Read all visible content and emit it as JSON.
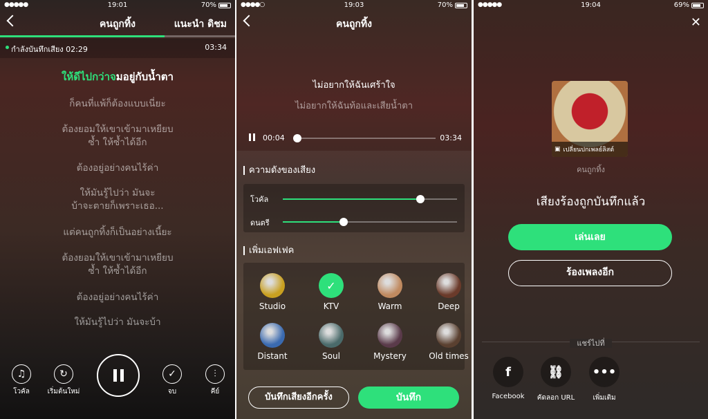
{
  "screens": [
    {
      "status": {
        "signal": "●●●●●",
        "time": "19:01",
        "battery": "70%",
        "battery_level": 0.7
      },
      "nav": {
        "title": "คนถูกทิ้ง",
        "artist": "แนะนำ ดิชม"
      },
      "progress": 0.7,
      "recording": {
        "label": "กำลังบันทึกเสียง 02:29",
        "total": "03:34"
      },
      "current_lyric": {
        "sung": "ให้ดีไปกว่าจ",
        "rest": "มอยู่กับน้ำตา"
      },
      "lyrics": [
        "ก็คนที่แพ้ก็ต้องแบบเนี่ยะ",
        "ต้องยอมให้เขาเข้ามาเหยียบ\nซ้ำ ให้ซ้ำได้อีก",
        "ต้องอยู่อย่างคนไร้ค่า",
        "ให้มันรู้ไปว่า มันจะ\nบ้าจะตายก็เพราะเธอ...",
        "แต่คนถูกทิ้งก็เป็นอย่างเนี้ยะ",
        "ต้องยอมให้เขาเข้ามาเหยียบ\nซ้ำ ให้ซ้ำได้อีก",
        "ต้องอยู่อย่างคนไร้ค่า",
        "ให้มันรู้ไปว่า มันจะบ้า"
      ],
      "controls": {
        "vocal": "โวคัล",
        "restart": "เริ่มต้นใหม่",
        "finish": "จบ",
        "key": "คีย์"
      }
    },
    {
      "status": {
        "signal": "●●●●○",
        "time": "19:03",
        "battery": "70%",
        "battery_level": 0.7
      },
      "nav": {
        "title": "คนถูกทิ้ง"
      },
      "lyrics": [
        "ไม่อยากให้ฉันเศร้าใจ",
        "ไม่อยากให้ฉันท้อและเสียน้ำตา"
      ],
      "player": {
        "current": "00:04",
        "total": "03:34",
        "progress": 0.02
      },
      "volume": {
        "title": "ความดังของเสียง",
        "vocal_label": "โวคัล",
        "vocal_level": 0.79,
        "music_label": "ดนตรี",
        "music_level": 0.35
      },
      "effects": {
        "title": "เพิ่มเอฟเฟค",
        "selected": "KTV",
        "items": [
          {
            "name": "Studio",
            "color": "#c9a020"
          },
          {
            "name": "KTV",
            "color": "#2ee07b"
          },
          {
            "name": "Warm",
            "color": "#c08a60"
          },
          {
            "name": "Deep",
            "color": "#6a3a2a"
          },
          {
            "name": "Distant",
            "color": "#3a6ab0"
          },
          {
            "name": "Soul",
            "color": "#4a6a6a"
          },
          {
            "name": "Mystery",
            "color": "#5a3a4a"
          },
          {
            "name": "Old times",
            "color": "#5a4030"
          }
        ]
      },
      "buttons": {
        "rerecord": "บันทึกเสียงอีกครั้ง",
        "save": "บันทึก"
      }
    },
    {
      "status": {
        "signal": "●●●●●",
        "time": "19:04",
        "battery": "69%",
        "battery_level": 0.69
      },
      "cover_caption": "เปลี่ยนปกเพลย์ลิสต์",
      "song": "คนถูกทิ้ง",
      "heading": "เสียงร้องถูกบันทึกแล้ว",
      "buttons": {
        "play": "เล่นเลย",
        "sing_again": "ร้องเพลงอีก"
      },
      "share": {
        "title": "แชร์ไปที่",
        "items": [
          {
            "label": "Facebook",
            "icon": "f"
          },
          {
            "label": "คัดลอก URL",
            "icon": "🔗"
          },
          {
            "label": "เพิ่มเติม",
            "icon": "•••"
          }
        ]
      }
    }
  ],
  "colors": {
    "accent": "#2ee07b"
  }
}
